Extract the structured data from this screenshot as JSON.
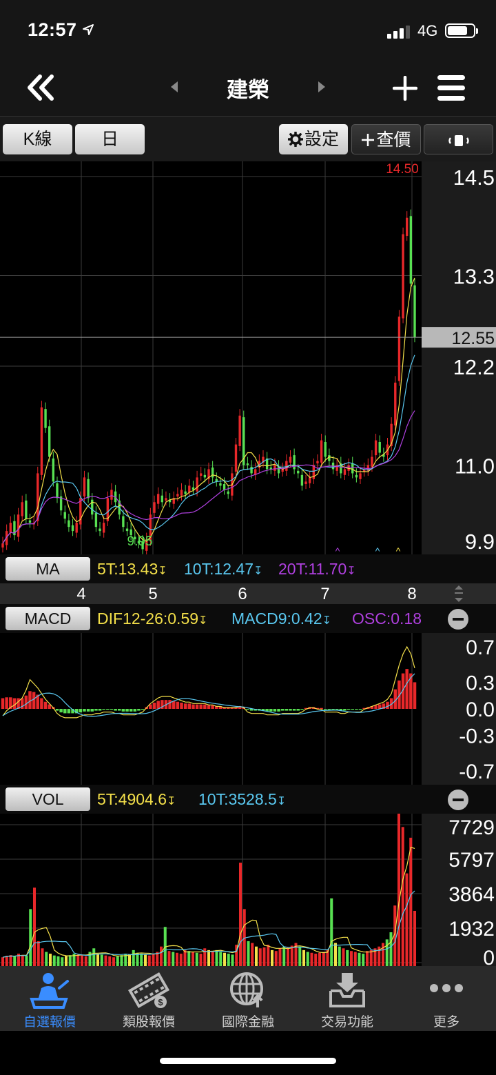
{
  "status": {
    "time": "12:57",
    "network": "4G"
  },
  "nav": {
    "title": "建榮"
  },
  "toolbar": {
    "kline_label": "K線",
    "period_label": "日",
    "settings_label": "設定",
    "quote_label": "查價"
  },
  "price_axis": [
    "14.5",
    "13.3",
    "12.2",
    "11.0",
    "9.9"
  ],
  "price_current": "12.55",
  "price_high_label": "14.50",
  "price_low_label": "9.95",
  "ma_bar": {
    "label": "MA",
    "t5": "5T:13.43",
    "t10": "10T:12.47",
    "t20": "20T:11.70"
  },
  "date_axis": [
    "4",
    "5",
    "6",
    "7",
    "8"
  ],
  "macd_bar": {
    "label": "MACD",
    "dif": "DIF12-26:0.59",
    "macd9": "MACD9:0.42",
    "osc": "OSC:0.18"
  },
  "macd_axis": [
    "0.7",
    "0.3",
    "0.0",
    "-0.3",
    "-0.7"
  ],
  "vol_bar": {
    "label": "VOL",
    "t5": "5T:4904.6",
    "t10": "10T:3528.5"
  },
  "vol_axis": [
    "7729",
    "5797",
    "3864",
    "1932",
    "0"
  ],
  "tabs": [
    {
      "label": "自選報價",
      "active": true
    },
    {
      "label": "類股報價",
      "active": false
    },
    {
      "label": "國際金融",
      "active": false
    },
    {
      "label": "交易功能",
      "active": false
    },
    {
      "label": "更多",
      "active": false
    }
  ],
  "colors": {
    "up": "#e8282a",
    "down": "#58e052",
    "ma5": "#f4e04a",
    "ma10": "#5ac8f0",
    "ma20": "#b040e0",
    "active_tab": "#3a8dff"
  },
  "chart_data": [
    {
      "type": "candlestick",
      "title": "",
      "x_ticks": [
        "4",
        "5",
        "6",
        "7",
        "8"
      ],
      "ylim": [
        9.9,
        14.6
      ],
      "y_ticks": [
        14.5,
        13.3,
        12.2,
        11.0,
        9.9
      ],
      "high": 14.5,
      "low": 9.95,
      "last": 12.55,
      "close": [
        10.05,
        10.2,
        10.3,
        10.15,
        10.4,
        10.55,
        10.35,
        10.3,
        10.3,
        10.9,
        11.7,
        11.45,
        11.1,
        10.8,
        10.6,
        10.45,
        10.35,
        10.25,
        10.2,
        10.3,
        10.6,
        10.85,
        10.6,
        10.4,
        10.25,
        10.2,
        10.3,
        10.6,
        10.7,
        10.55,
        10.4,
        10.25,
        10.2,
        10.15,
        10.1,
        10.05,
        9.98,
        10.1,
        10.4,
        10.55,
        10.65,
        10.55,
        10.6,
        10.55,
        10.6,
        10.65,
        10.7,
        10.65,
        10.75,
        10.7,
        10.85,
        10.9,
        10.85,
        10.95,
        10.85,
        10.8,
        10.75,
        10.7,
        10.65,
        10.9,
        11.25,
        11.6,
        11.0,
        11.0,
        10.9,
        10.95,
        11.05,
        11.1,
        10.95,
        10.95,
        11.0,
        10.9,
        10.95,
        11.05,
        11.1,
        10.95,
        10.9,
        10.75,
        10.8,
        10.85,
        11.0,
        11.05,
        11.3,
        11.1,
        11.05,
        10.95,
        11.0,
        10.9,
        10.95,
        11.0,
        10.9,
        10.85,
        10.9,
        10.95,
        11.0,
        11.1,
        11.3,
        11.15,
        11.1,
        11.25,
        11.5,
        12.0,
        12.8,
        13.8,
        14.0,
        13.2,
        12.55
      ],
      "series": [
        {
          "name": "5T",
          "last": 13.43
        },
        {
          "name": "10T",
          "last": 12.47
        },
        {
          "name": "20T",
          "last": 11.7
        }
      ]
    },
    {
      "type": "bar",
      "title": "",
      "ylim": [
        -0.7,
        0.7
      ],
      "y_ticks": [
        0.7,
        0.3,
        0.0,
        -0.3,
        -0.7
      ],
      "values": [
        0.12,
        0.13,
        0.13,
        0.12,
        0.12,
        0.12,
        0.15,
        0.2,
        0.19,
        0.16,
        0.12,
        0.08,
        0.05,
        0.02,
        -0.02,
        -0.04,
        -0.05,
        -0.05,
        -0.05,
        -0.05,
        -0.04,
        -0.03,
        -0.03,
        -0.03,
        -0.02,
        -0.02,
        -0.01,
        -0.01,
        -0.01,
        -0.02,
        -0.02,
        -0.03,
        -0.03,
        -0.03,
        -0.03,
        -0.02,
        -0.01,
        0.02,
        0.05,
        0.07,
        0.09,
        0.1,
        0.1,
        0.1,
        0.09,
        0.08,
        0.07,
        0.06,
        0.06,
        0.05,
        0.05,
        0.05,
        0.05,
        0.04,
        0.04,
        0.03,
        0.03,
        0.02,
        0.02,
        0.02,
        0.02,
        0.03,
        0.02,
        -0.01,
        -0.02,
        -0.02,
        -0.02,
        -0.02,
        -0.03,
        -0.03,
        -0.03,
        -0.03,
        -0.02,
        -0.02,
        -0.02,
        -0.02,
        -0.02,
        -0.01,
        0.01,
        0.02,
        0.02,
        0.01,
        0.01,
        -0.01,
        -0.01,
        -0.01,
        -0.01,
        -0.02,
        -0.02,
        -0.01,
        -0.01,
        -0.01,
        -0.01,
        0.01,
        0.02,
        0.03,
        0.04,
        0.05,
        0.06,
        0.08,
        0.12,
        0.22,
        0.32,
        0.4,
        0.45,
        0.4,
        0.3
      ],
      "series": [
        {
          "name": "DIF12-26",
          "last": 0.59
        },
        {
          "name": "MACD9",
          "last": 0.42
        },
        {
          "name": "OSC",
          "last": 0.18
        }
      ]
    },
    {
      "type": "bar",
      "title": "",
      "ylim": [
        0,
        7729
      ],
      "y_ticks": [
        7729,
        5797,
        3864,
        1932,
        0
      ],
      "values": [
        300,
        380,
        420,
        350,
        500,
        420,
        400,
        3000,
        4200,
        1200,
        800,
        600,
        500,
        400,
        350,
        300,
        380,
        420,
        500,
        450,
        400,
        350,
        600,
        800,
        500,
        450,
        400,
        350,
        300,
        380,
        420,
        500,
        450,
        700,
        550,
        500,
        450,
        400,
        500,
        600,
        900,
        2000,
        650,
        600,
        550,
        500,
        700,
        650,
        600,
        550,
        500,
        800,
        700,
        650,
        700,
        600,
        550,
        500,
        450,
        1000,
        5600,
        3000,
        1200,
        1100,
        900,
        800,
        850,
        1000,
        700,
        650,
        800,
        900,
        850,
        950,
        1100,
        900,
        700,
        600,
        550,
        500,
        550,
        600,
        700,
        3600,
        1100,
        900,
        800,
        700,
        650,
        600,
        550,
        500,
        650,
        700,
        800,
        900,
        1100,
        1300,
        1700,
        3200,
        9500,
        7600,
        5000,
        7000,
        2900
      ],
      "series": [
        {
          "name": "5T",
          "last": 4904.6
        },
        {
          "name": "10T",
          "last": 3528.5
        }
      ]
    }
  ]
}
